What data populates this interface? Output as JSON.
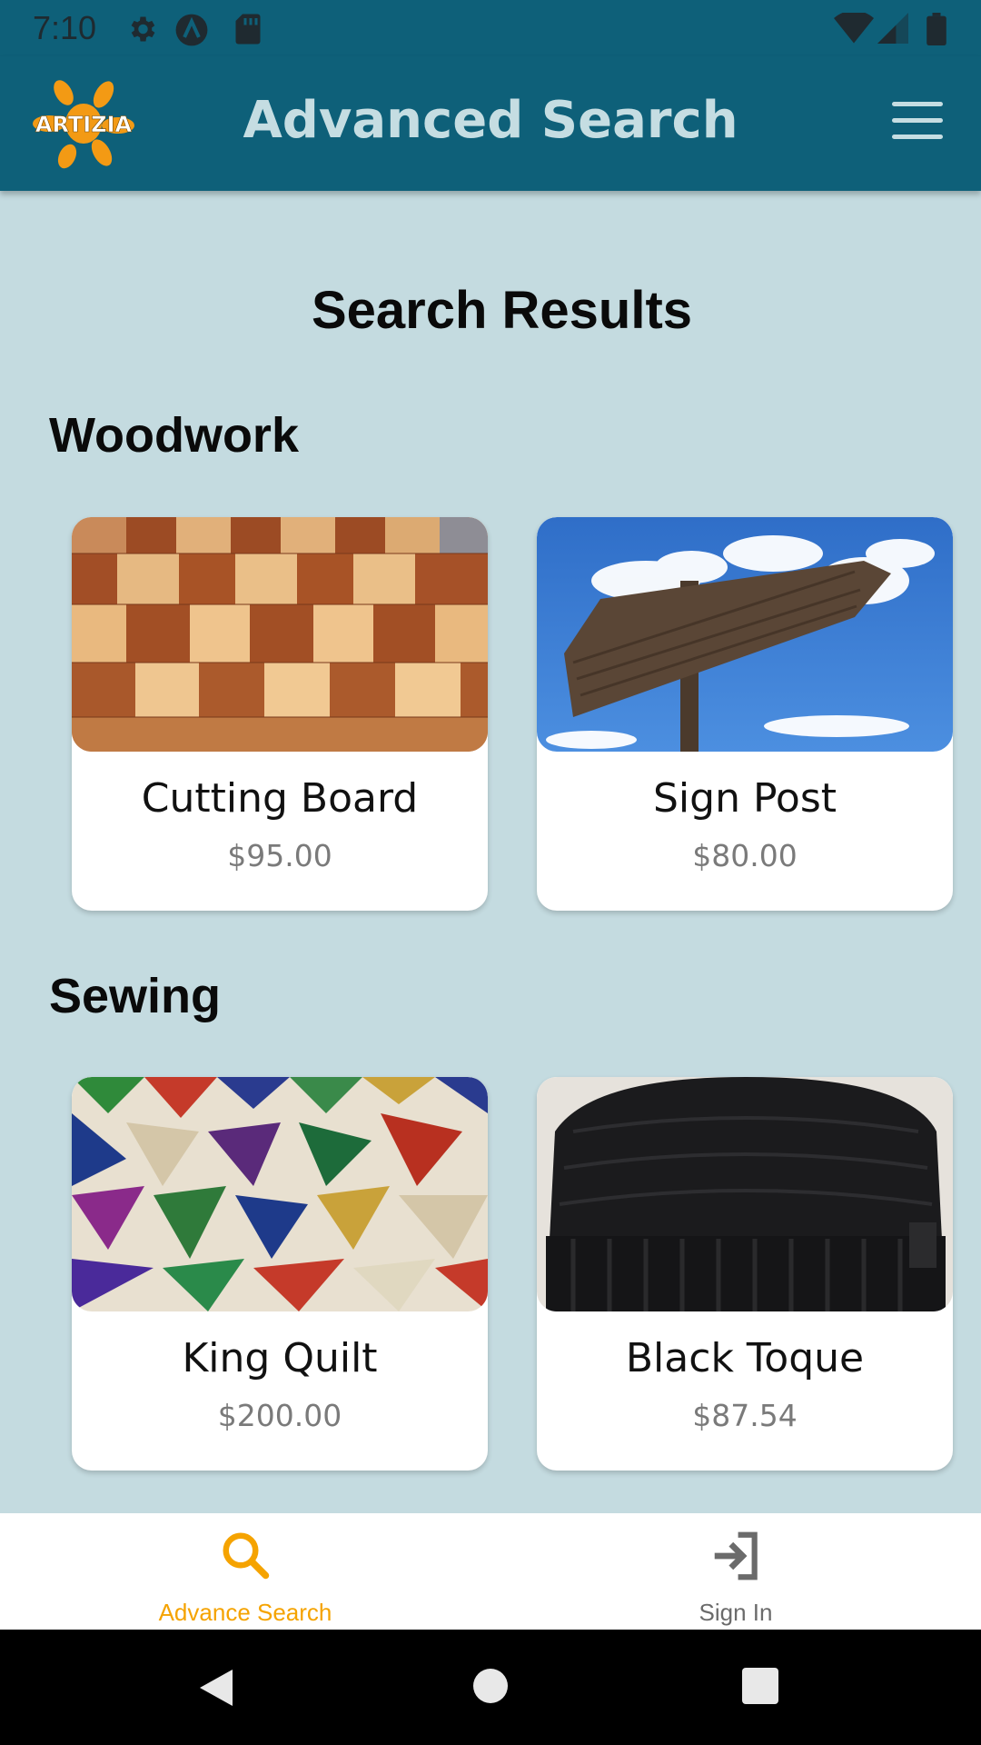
{
  "status_bar": {
    "time": "7:10"
  },
  "app_bar": {
    "logo_text": "ARTIZIA",
    "title": "Advanced Search"
  },
  "results_title": "Search Results",
  "sections": [
    {
      "title": "Woodwork",
      "items": [
        {
          "name": "Cutting Board",
          "price": "$95.00"
        },
        {
          "name": "Sign Post",
          "price": "$80.00"
        }
      ]
    },
    {
      "title": "Sewing",
      "items": [
        {
          "name": "King Quilt",
          "price": "$200.00"
        },
        {
          "name": "Black Toque",
          "price": "$87.54"
        }
      ]
    }
  ],
  "bottom_nav": {
    "items": [
      {
        "label": "Advance Search",
        "icon": "search-icon",
        "active": true
      },
      {
        "label": "Sign In",
        "icon": "sign-in-icon",
        "active": false
      }
    ],
    "active_color": "#f5a300",
    "inactive_color": "#6b6b6b"
  },
  "colors": {
    "primary": "#0e6079",
    "background": "#c4dbe0",
    "accent": "#f5a300"
  }
}
